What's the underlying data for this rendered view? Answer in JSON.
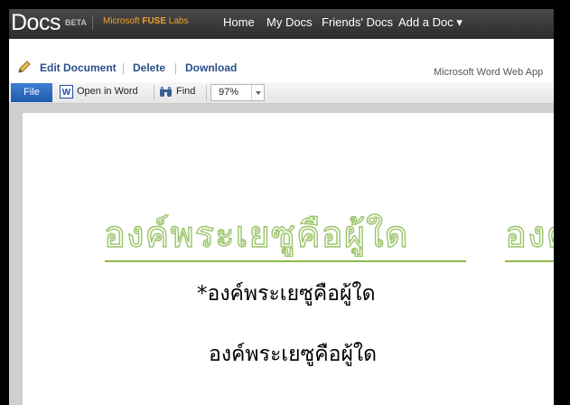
{
  "header": {
    "logo": "Docs",
    "beta": "BETA",
    "lab_prefix": "Microsoft ",
    "lab_bold": "FUSE",
    "lab_suffix": " Labs",
    "nav": [
      "Home",
      "My Docs",
      "Friends' Docs",
      "Add a Doc ▾"
    ]
  },
  "actions": {
    "edit": "Edit Document",
    "delete": "Delete",
    "download": "Download",
    "app_name": "Microsoft Word Web App"
  },
  "toolbar": {
    "file": "File",
    "open_in_word": "Open in Word",
    "word_icon_letter": "W",
    "find": "Find",
    "zoom": "97%"
  },
  "document": {
    "title": "องค์พระเยซูคือผู้ใด",
    "title_next": "องค์พระเยซูคือผู้ใด",
    "line1": "*องค์พระเยซูคือผู้ใด",
    "line2": "องค์พระเยซูคือผู้ใด"
  },
  "colors": {
    "accent_green": "#8dbb4d",
    "link_blue": "#2a4f8a",
    "lab_orange": "#f2a32a",
    "file_blue": "#2767bf"
  }
}
